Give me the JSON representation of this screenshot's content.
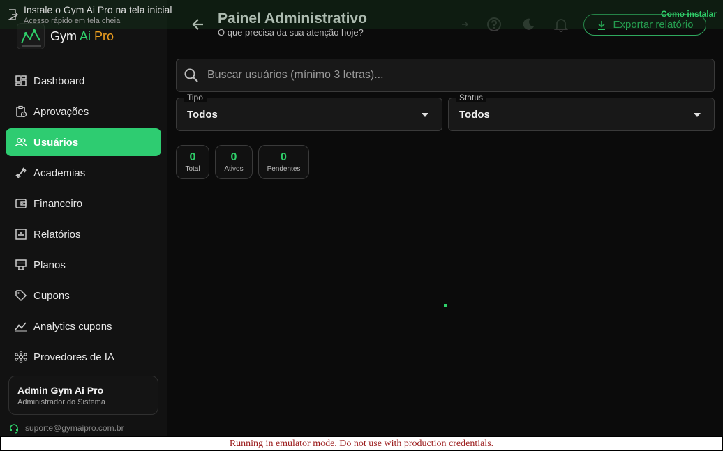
{
  "install_banner": {
    "title": "Instale o Gym Ai Pro na tela inicial",
    "subtitle": "Acesso rápido em tela cheia",
    "how_link": "Como instalar",
    "icon": "install-app-icon"
  },
  "brand": {
    "name_part1": "Gym ",
    "name_part2": "Ai",
    "name_part3": " Pro",
    "logo_text": "GYM AI PRO"
  },
  "sidebar": {
    "items": [
      {
        "label": "Dashboard",
        "icon": "dashboard-icon",
        "active": false
      },
      {
        "label": "Aprovações",
        "icon": "approval-icon",
        "active": false
      },
      {
        "label": "Usuários",
        "icon": "users-icon",
        "active": true
      },
      {
        "label": "Academias",
        "icon": "dumbbell-icon",
        "active": false
      },
      {
        "label": "Financeiro",
        "icon": "wallet-icon",
        "active": false
      },
      {
        "label": "Relatórios",
        "icon": "report-icon",
        "active": false
      },
      {
        "label": "Planos",
        "icon": "plans-icon",
        "active": false
      },
      {
        "label": "Cupons",
        "icon": "tag-icon",
        "active": false
      },
      {
        "label": "Analytics cupons",
        "icon": "analytics-icon",
        "active": false
      },
      {
        "label": "Provedores de IA",
        "icon": "hub-icon",
        "active": false
      }
    ],
    "user": {
      "name": "Admin Gym Ai Pro",
      "role": "Administrador do Sistema"
    },
    "support_email": "suporte@gymaipro.com.br"
  },
  "header": {
    "title": "Painel Administrativo",
    "subtitle": "O que precisa da sua atenção hoje?",
    "export_label": "Exportar relatório",
    "icons": [
      "arrow-forward-icon",
      "help-icon",
      "dark-mode-icon",
      "notifications-icon"
    ]
  },
  "filters": {
    "search_placeholder": "Buscar usuários (mínimo 3 letras)...",
    "search_value": "",
    "tipo_label": "Tipo",
    "tipo_value": "Todos",
    "status_label": "Status",
    "status_value": "Todos"
  },
  "stats": [
    {
      "value": "0",
      "label": "Total"
    },
    {
      "value": "0",
      "label": "Ativos"
    },
    {
      "value": "0",
      "label": "Pendentes"
    }
  ],
  "colors": {
    "accent": "#2ecc71",
    "background": "#0b0b0b",
    "panel": "#121212"
  },
  "emulator_warning": "Running in emulator mode. Do not use with production credentials."
}
